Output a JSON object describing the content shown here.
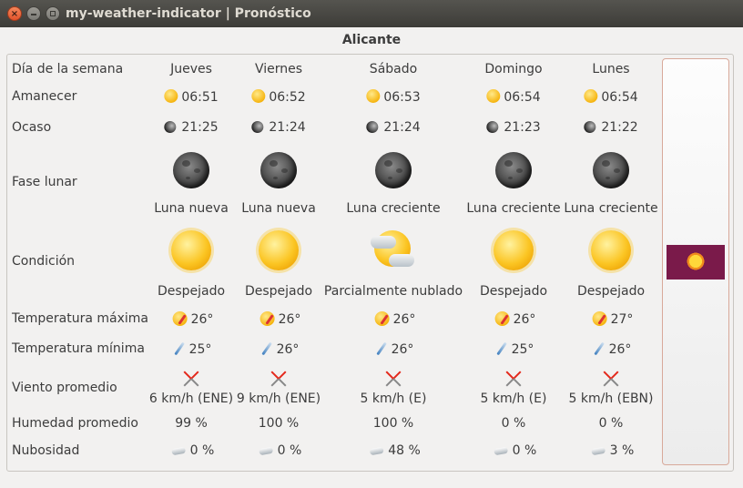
{
  "window": {
    "title": "my-weather-indicator | Pronóstico"
  },
  "location": "Alicante",
  "row_labels": {
    "day": "Día de la semana",
    "sunrise": "Amanecer",
    "sunset": "Ocaso",
    "moon_phase": "Fase lunar",
    "condition": "Condición",
    "temp_max": "Temperatura máxima",
    "temp_min": "Temperatura mínima",
    "wind": "Viento promedio",
    "humidity": "Humedad promedio",
    "cloudiness": "Nubosidad"
  },
  "days": [
    {
      "name": "Jueves",
      "sunrise": "06:51",
      "sunset": "21:25",
      "moon_phase": "Luna nueva",
      "condition": "Despejado",
      "condition_icon": "sunny-icon",
      "temp_max": "26°",
      "temp_min": "25°",
      "wind": "6 km/h (ENE)",
      "humidity": "99 %",
      "cloudiness": "0 %"
    },
    {
      "name": "Viernes",
      "sunrise": "06:52",
      "sunset": "21:24",
      "moon_phase": "Luna nueva",
      "condition": "Despejado",
      "condition_icon": "sunny-icon",
      "temp_max": "26°",
      "temp_min": "26°",
      "wind": "9 km/h (ENE)",
      "humidity": "100 %",
      "cloudiness": "0 %"
    },
    {
      "name": "Sábado",
      "sunrise": "06:53",
      "sunset": "21:24",
      "moon_phase": "Luna creciente",
      "condition": "Parcialmente nublado",
      "condition_icon": "partly-cloudy-icon",
      "temp_max": "26°",
      "temp_min": "26°",
      "wind": "5 km/h (E)",
      "humidity": "100 %",
      "cloudiness": "48 %"
    },
    {
      "name": "Domingo",
      "sunrise": "06:54",
      "sunset": "21:23",
      "moon_phase": "Luna creciente",
      "condition": "Despejado",
      "condition_icon": "sunny-icon",
      "temp_max": "26°",
      "temp_min": "25°",
      "wind": "5 km/h (E)",
      "humidity": "0 %",
      "cloudiness": "0 %"
    },
    {
      "name": "Lunes",
      "sunrise": "06:54",
      "sunset": "21:22",
      "moon_phase": "Luna creciente",
      "condition": "Despejado",
      "condition_icon": "sunny-icon",
      "temp_max": "27°",
      "temp_min": "26°",
      "wind": "5 km/h (EBN)",
      "humidity": "0 %",
      "cloudiness": "3 %"
    }
  ],
  "colors": {
    "title_bar": "#3d3c38",
    "close_button": "#e2532b",
    "logo_background": "#7a1a4a"
  }
}
